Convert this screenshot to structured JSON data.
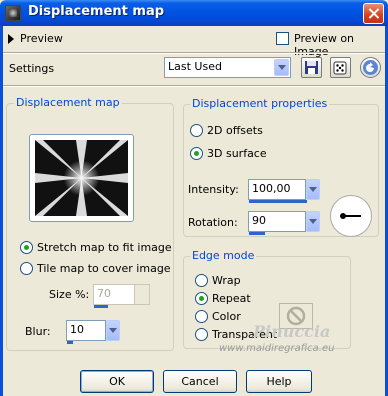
{
  "window": {
    "title": "Displacement map"
  },
  "preview_row": {
    "label": "Preview",
    "preview_on_image": "Preview on Image"
  },
  "settings": {
    "label": "Settings",
    "value": "Last Used"
  },
  "displacement_map": {
    "title": "Displacement map",
    "stretch": "Stretch map to fit image",
    "tile": "Tile map to cover image",
    "size_label": "Size %:",
    "size_value": "70",
    "blur_label": "Blur:",
    "blur_value": "10"
  },
  "properties": {
    "title": "Displacement properties",
    "offsets": "2D offsets",
    "surface": "3D surface",
    "intensity_label": "Intensity:",
    "intensity_value": "100,00",
    "rotation_label": "Rotation:",
    "rotation_value": "90"
  },
  "edge_mode": {
    "title": "Edge mode",
    "wrap": "Wrap",
    "repeat": "Repeat",
    "color": "Color",
    "transparent": "Transparent"
  },
  "buttons": {
    "ok": "OK",
    "cancel": "Cancel",
    "help": "Help"
  },
  "watermark": {
    "name": "Pinuccia",
    "url": "www.maidiregrafica.eu"
  },
  "colors": {
    "title_blue": "#0054e3",
    "group_title": "#0046d5",
    "radio_dot": "#21a121"
  }
}
